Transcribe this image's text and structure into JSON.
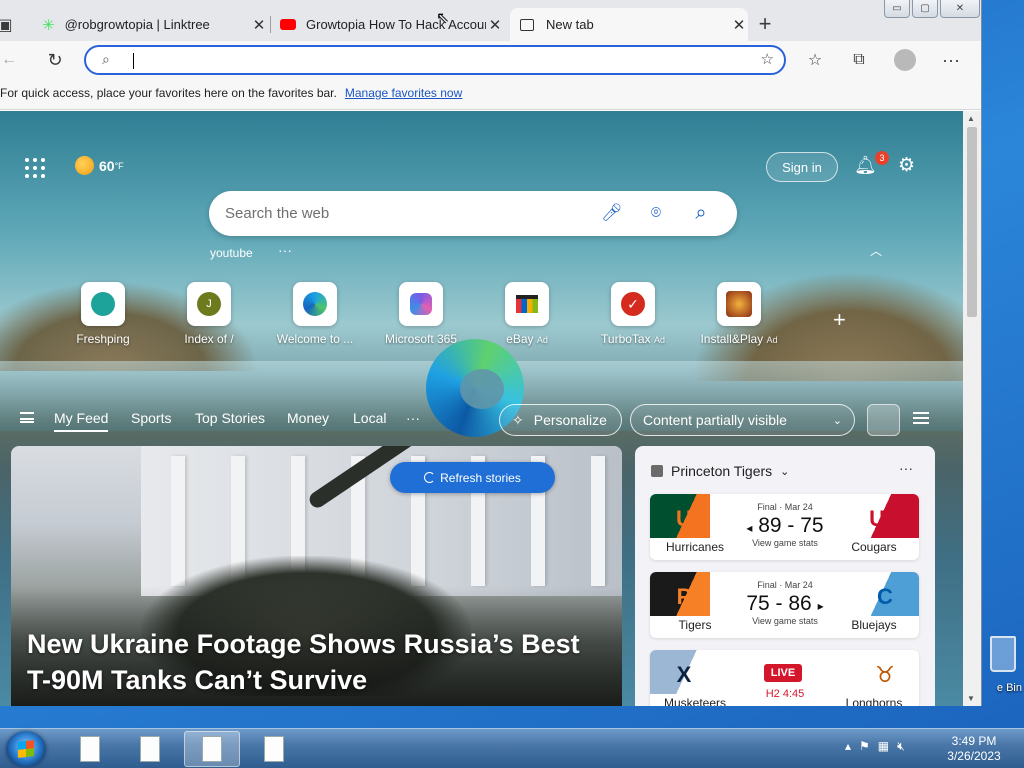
{
  "browser": {
    "tabs": [
      {
        "title": "@robgrowtopia | Linktree",
        "icon": "linktree-icon",
        "active": false
      },
      {
        "title": "Growtopia How To Hack Account",
        "icon": "youtube-icon",
        "active": false
      },
      {
        "title": "New tab",
        "icon": "newtab-icon",
        "active": true
      }
    ],
    "window_controls": {
      "minimize": "▭",
      "maximize": "▢",
      "close": "✕"
    },
    "address_value": "",
    "favorites_bar": {
      "text": "For quick access, place your favorites here on the favorites bar.",
      "link": "Manage favorites now"
    }
  },
  "ntp": {
    "weather": {
      "temp": "60",
      "unit": "°F"
    },
    "sign_in": "Sign in",
    "notifications_count": "3",
    "search_placeholder": "Search the web",
    "recent_search": "youtube",
    "quick_links": [
      {
        "name": "Freshping",
        "ad": ""
      },
      {
        "name": "Index of /",
        "ad": ""
      },
      {
        "name": "Welcome to ...",
        "ad": ""
      },
      {
        "name": "Microsoft 365",
        "ad": ""
      },
      {
        "name": "eBay",
        "ad": "Ad"
      },
      {
        "name": "TurboTax",
        "ad": "Ad"
      },
      {
        "name": "Install&Play",
        "ad": "Ad"
      }
    ],
    "feed_nav": {
      "items": [
        "My Feed",
        "Sports",
        "Top Stories",
        "Money",
        "Local"
      ],
      "more": "···",
      "personalize": "Personalize",
      "content_visibility": "Content partially visible"
    },
    "refresh_label": "Refresh stories",
    "hero_headline": "New Ukraine Footage Shows Russia’s Best T-90M Tanks Can’t Survive",
    "sports_card": {
      "title": "Princeton Tigers",
      "more": "···",
      "games": [
        {
          "left_team": "Hurricanes",
          "right_team": "Cougars",
          "status": "Final · Mar 24",
          "score": "89 - 75",
          "winner_arrow": "◂",
          "stats": "View game stats",
          "left_color": "#005030",
          "left_accent": "#f47321",
          "right_color": "#c8102e"
        },
        {
          "left_team": "Tigers",
          "right_team": "Bluejays",
          "status": "Final · Mar 24",
          "score": "75 - 86",
          "winner_arrow": "▸",
          "stats": "View game stats",
          "left_color": "#1a1a1a",
          "left_accent": "#f58025",
          "right_color": "#005ca9"
        },
        {
          "left_team": "Musketeers",
          "right_team": "Longhorns",
          "live": "LIVE",
          "clock": "H2 4:45",
          "left_color": "#0c2340",
          "right_color": "#bf5700"
        }
      ]
    }
  },
  "taskbar": {
    "time": "3:49 PM",
    "date": "3/26/2023",
    "desktop_label": "e Bin"
  },
  "colors": {
    "accent": "#1f6fd6",
    "address_border": "#2b62d9",
    "notification_badge": "#e8412b"
  }
}
